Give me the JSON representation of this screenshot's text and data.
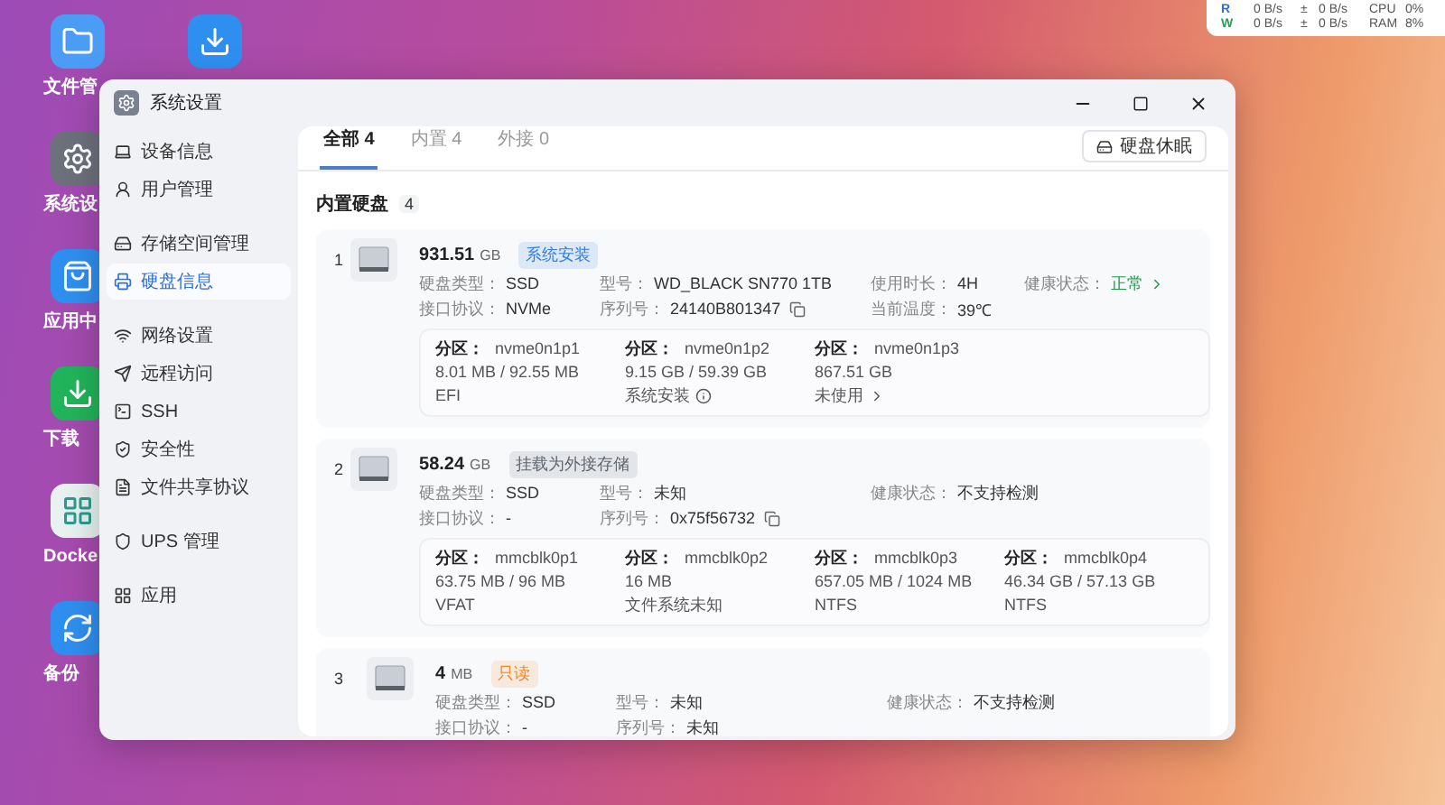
{
  "desktop_icons": [
    {
      "label": "文件管"
    },
    {
      "label": "系统设"
    },
    {
      "label": "应用中"
    },
    {
      "label": "下载"
    },
    {
      "label": "Docke"
    },
    {
      "label": "备份"
    }
  ],
  "status_widget": {
    "rows": [
      {
        "key": "R",
        "read": "0 B/s",
        "sign": "±",
        "write": "0 B/s",
        "metric": "CPU",
        "value": "0%"
      },
      {
        "key": "W",
        "read": "0 B/s",
        "sign": "±",
        "write": "0 B/s",
        "metric": "RAM",
        "value": "8%"
      }
    ]
  },
  "window": {
    "title": "系统设置"
  },
  "sidebar": {
    "groups": [
      [
        {
          "label": "设备信息",
          "selected": false
        },
        {
          "label": "用户管理",
          "selected": false
        }
      ],
      [
        {
          "label": "存储空间管理",
          "selected": false
        },
        {
          "label": "硬盘信息",
          "selected": true
        }
      ],
      [
        {
          "label": "网络设置",
          "selected": false
        },
        {
          "label": "远程访问",
          "selected": false
        },
        {
          "label": "SSH",
          "selected": false
        },
        {
          "label": "安全性",
          "selected": false
        },
        {
          "label": "文件共享协议",
          "selected": false
        }
      ],
      [
        {
          "label": "UPS 管理",
          "selected": false
        }
      ],
      [
        {
          "label": "应用",
          "selected": false
        }
      ]
    ]
  },
  "tabs": [
    {
      "label": "全部 4",
      "selected": true
    },
    {
      "label": "内置 4",
      "selected": false
    },
    {
      "label": "外接 0",
      "selected": false
    }
  ],
  "sleep_button": "硬盘休眠",
  "section": {
    "title": "内置硬盘",
    "count": "4"
  },
  "disks": [
    {
      "index": "1",
      "size": "931.51",
      "unit": "GB",
      "tag": {
        "label": "系统安装",
        "color": "#2f7de1"
      },
      "rows": [
        [
          {
            "label": "硬盘类型：",
            "value": "SSD",
            "kind": "text"
          },
          {
            "label": "型号：",
            "value": "WD_BLACK SN770 1TB",
            "kind": "text"
          },
          {
            "label": "使用时长：",
            "value": "4H",
            "kind": "text"
          },
          {
            "label": "健康状态：",
            "value": "正常",
            "kind": "status"
          }
        ],
        [
          {
            "label": "接口协议：",
            "value": "NVMe",
            "kind": "text"
          },
          {
            "label": "序列号：",
            "value": "24140B801347",
            "kind": "copy"
          },
          {
            "label": "当前温度：",
            "value": "39℃",
            "kind": "text"
          }
        ]
      ],
      "partitions": [
        {
          "label": "分区：",
          "name": "nvme0n1p1",
          "usage": "8.01 MB / 92.55 MB",
          "note": "EFI",
          "kind": "plain"
        },
        {
          "label": "分区：",
          "name": "nvme0n1p2",
          "usage": "9.15 GB / 59.39 GB",
          "note": "系统安装",
          "kind": "info"
        },
        {
          "label": "分区：",
          "name": "nvme0n1p3",
          "usage": "867.51 GB",
          "note": "未使用",
          "kind": "link"
        }
      ]
    },
    {
      "index": "2",
      "size": "58.24",
      "unit": "GB",
      "tag": {
        "label": "挂载为外接存储",
        "color": "#606770"
      },
      "rows": [
        [
          {
            "label": "硬盘类型：",
            "value": "SSD",
            "kind": "text"
          },
          {
            "label": "型号：",
            "value": "未知",
            "kind": "text"
          },
          {
            "label": "健康状态：",
            "value": "不支持检测",
            "kind": "text"
          }
        ],
        [
          {
            "label": "接口协议：",
            "value": "-",
            "kind": "text"
          },
          {
            "label": "序列号：",
            "value": "0x75f56732",
            "kind": "copy"
          }
        ]
      ],
      "partitions": [
        {
          "label": "分区：",
          "name": "mmcblk0p1",
          "usage": "63.75 MB / 96 MB",
          "note": "VFAT",
          "kind": "plain"
        },
        {
          "label": "分区：",
          "name": "mmcblk0p2",
          "usage": "16 MB",
          "note": "文件系统未知",
          "kind": "plain"
        },
        {
          "label": "分区：",
          "name": "mmcblk0p3",
          "usage": "657.05 MB / 1024 MB",
          "note": "NTFS",
          "kind": "plain"
        },
        {
          "label": "分区：",
          "name": "mmcblk0p4",
          "usage": "46.34 GB / 57.13 GB",
          "note": "NTFS",
          "kind": "plain"
        }
      ]
    },
    {
      "index": "3",
      "size": "4",
      "unit": "MB",
      "tag": {
        "label": "只读",
        "color": "#f08a24"
      },
      "rows": [
        [
          {
            "label": "硬盘类型：",
            "value": "SSD",
            "kind": "text"
          },
          {
            "label": "型号：",
            "value": "未知",
            "kind": "text"
          },
          {
            "label": "健康状态：",
            "value": "不支持检测",
            "kind": "text"
          }
        ],
        [
          {
            "label": "接口协议：",
            "value": "-",
            "kind": "text"
          },
          {
            "label": "序列号：",
            "value": "未知",
            "kind": "text"
          }
        ]
      ]
    }
  ]
}
